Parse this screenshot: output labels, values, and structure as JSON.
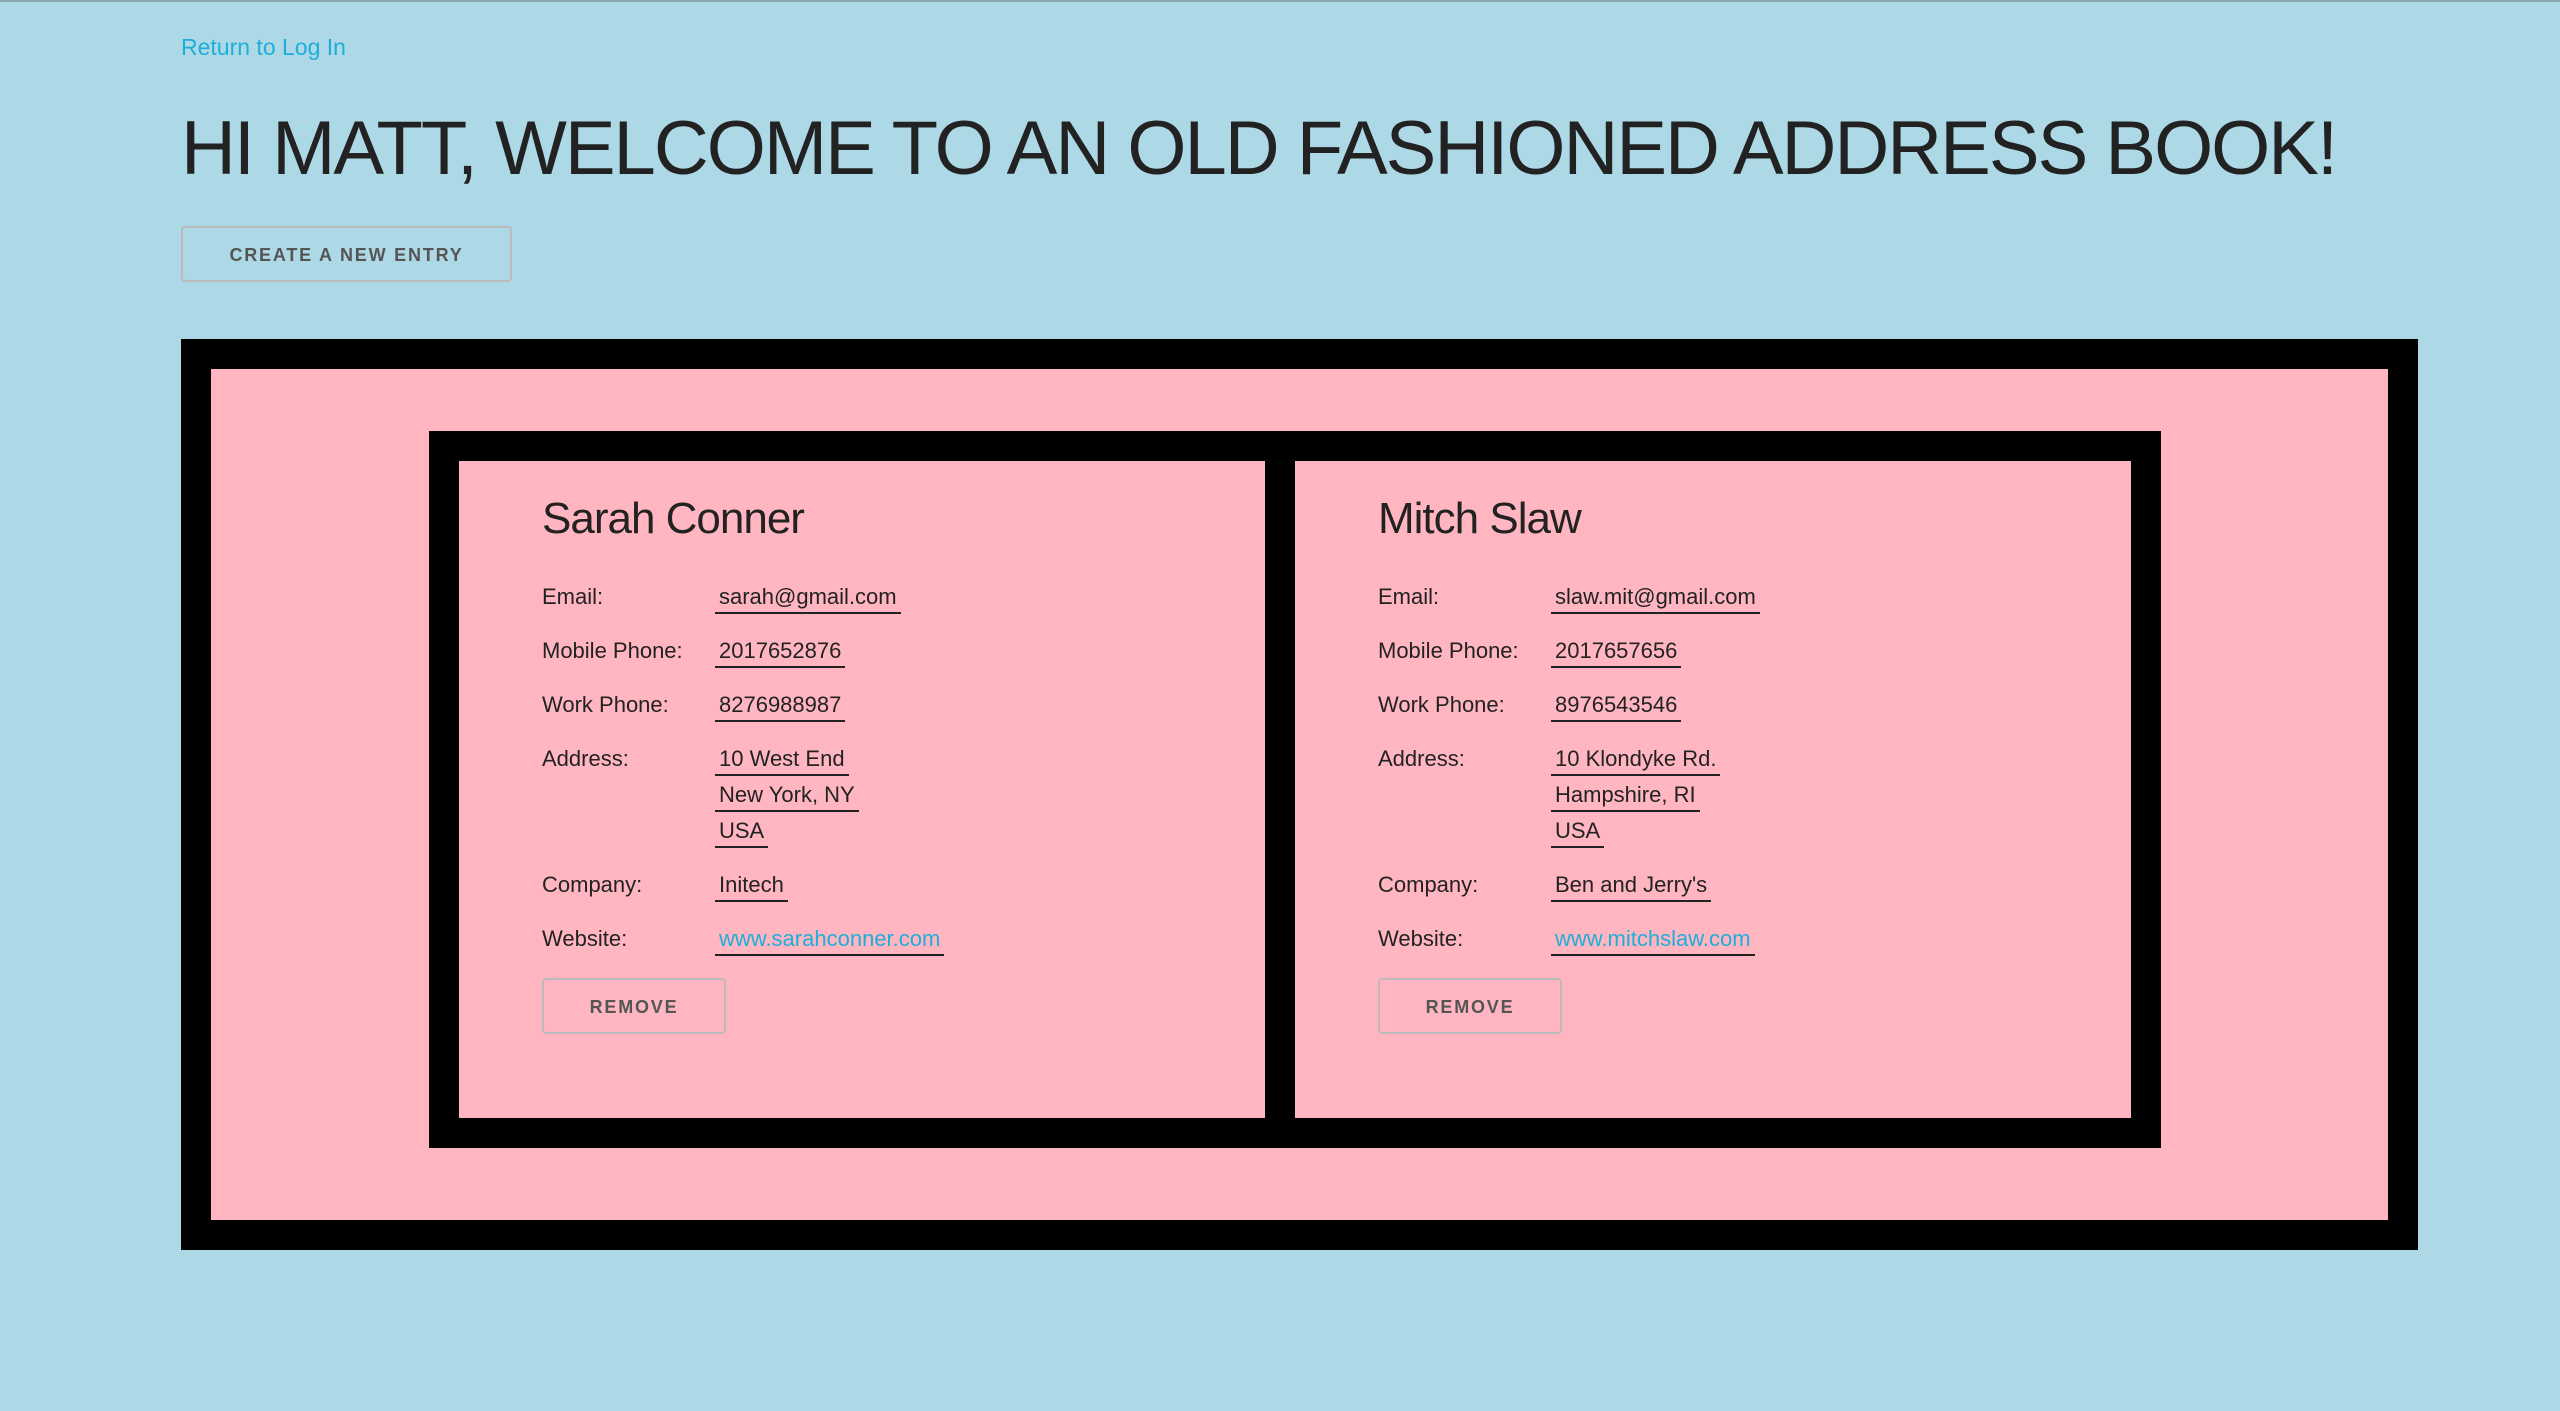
{
  "nav": {
    "back_link": "Return to Log In"
  },
  "header": {
    "title": "HI MATT, WELCOME TO AN OLD FASHIONED ADDRESS BOOK!",
    "create_button": "CREATE A NEW ENTRY"
  },
  "labels": {
    "email": "Email:",
    "mobile": "Mobile Phone:",
    "work": "Work Phone:",
    "address": "Address:",
    "company": "Company:",
    "website": "Website:",
    "remove": "REMOVE"
  },
  "contacts": [
    {
      "name": "Sarah Conner",
      "email": "sarah@gmail.com",
      "mobile": "2017652876",
      "work": "8276988987",
      "address": [
        "10 West End",
        "New York, NY",
        "USA"
      ],
      "company": "Initech",
      "website": "www.sarahconner.com"
    },
    {
      "name": "Mitch Slaw",
      "email": "slaw.mit@gmail.com",
      "mobile": "2017657656",
      "work": "8976543546",
      "address": [
        "10 Klondyke Rd.",
        "Hampshire, RI",
        "USA"
      ],
      "company": "Ben and Jerry's",
      "website": "www.mitchslaw.com"
    }
  ],
  "colors": {
    "page_background": "#add8e6",
    "card_background": "#ffb6c1",
    "frame": "#000000",
    "link": "#1eaedb",
    "text": "#222222"
  }
}
